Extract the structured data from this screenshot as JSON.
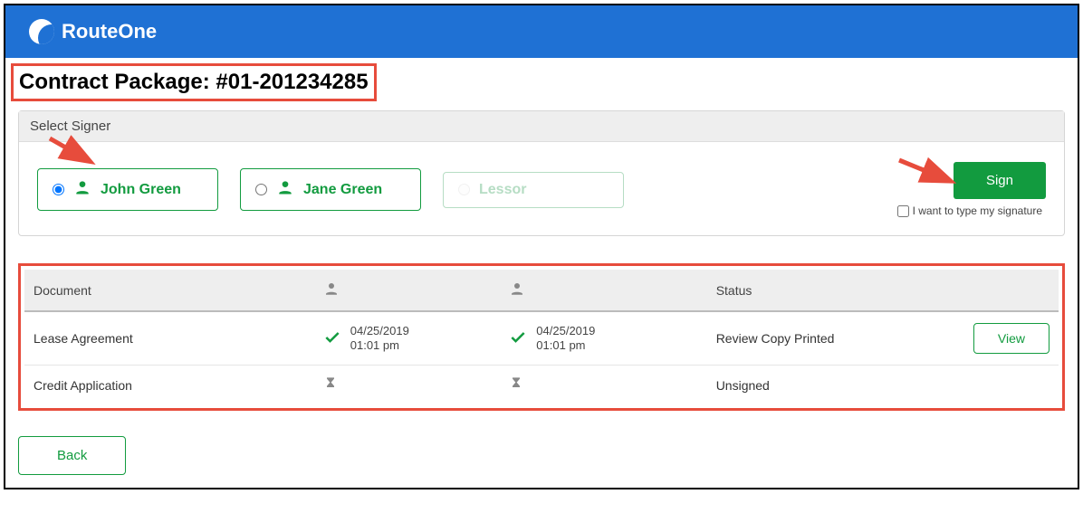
{
  "header": {
    "brand": "RouteOne"
  },
  "title": "Contract Package: #01-201234285",
  "signer_panel": {
    "header": "Select Signer",
    "signers": [
      {
        "name": "John Green",
        "selected": true,
        "enabled": true
      },
      {
        "name": "Jane Green",
        "selected": false,
        "enabled": true
      },
      {
        "name": "Lessor",
        "selected": false,
        "enabled": false
      }
    ],
    "sign_button": "Sign",
    "type_signature_label": "I want to type my signature"
  },
  "documents": {
    "columns": {
      "doc": "Document",
      "status": "Status"
    },
    "rows": [
      {
        "name": "Lease Agreement",
        "signer1": {
          "state": "signed",
          "date": "04/25/2019",
          "time": "01:01 pm"
        },
        "signer2": {
          "state": "signed",
          "date": "04/25/2019",
          "time": "01:01 pm"
        },
        "status": "Review Copy Printed",
        "action": "View"
      },
      {
        "name": "Credit Application",
        "signer1": {
          "state": "pending"
        },
        "signer2": {
          "state": "pending"
        },
        "status": "Unsigned",
        "action": null
      }
    ]
  },
  "back_button": "Back"
}
